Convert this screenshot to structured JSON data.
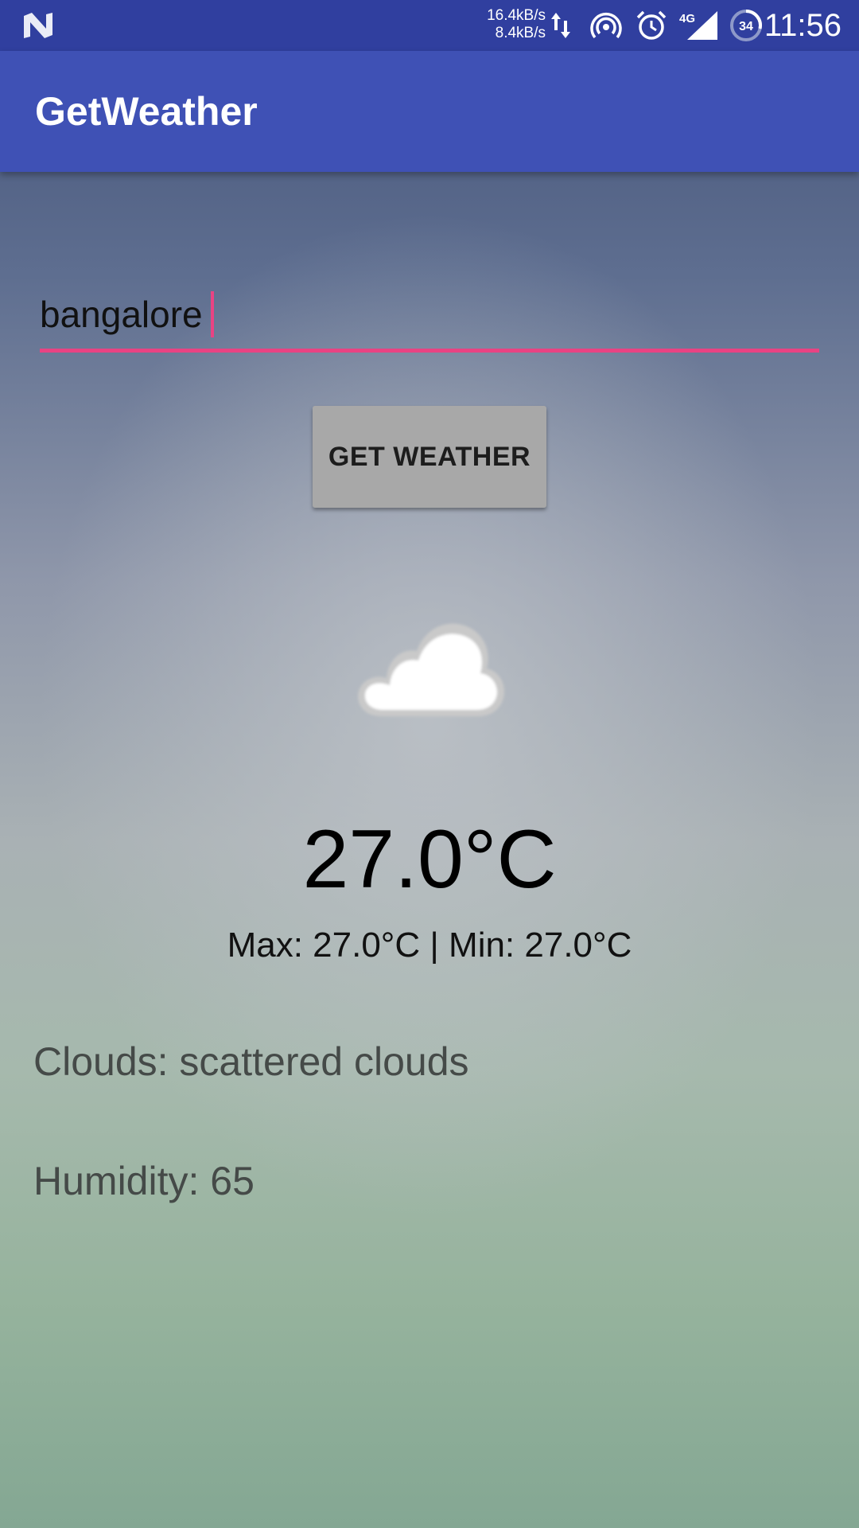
{
  "status_bar": {
    "net_up": "16.4kB/s",
    "net_down": "8.4kB/s",
    "network_type": "4G",
    "battery": "34",
    "time": "11:56",
    "icons": [
      "notification-n-icon",
      "data-transfer-icon",
      "hotspot-icon",
      "alarm-icon",
      "signal-4g-icon",
      "battery-icon"
    ]
  },
  "app_bar": {
    "title": "GetWeather"
  },
  "search": {
    "value": "bangalore"
  },
  "button": {
    "label": "GET WEATHER"
  },
  "weather": {
    "icon": "cloud-icon",
    "temperature": "27.0°C",
    "max_min": "Max: 27.0°C | Min: 27.0°C",
    "clouds": "Clouds: scattered clouds",
    "humidity": "Humidity: 65"
  },
  "colors": {
    "status_bar": "#303f9f",
    "app_bar": "#3f51b5",
    "accent": "#e94383",
    "button": "#a8a8a8"
  }
}
